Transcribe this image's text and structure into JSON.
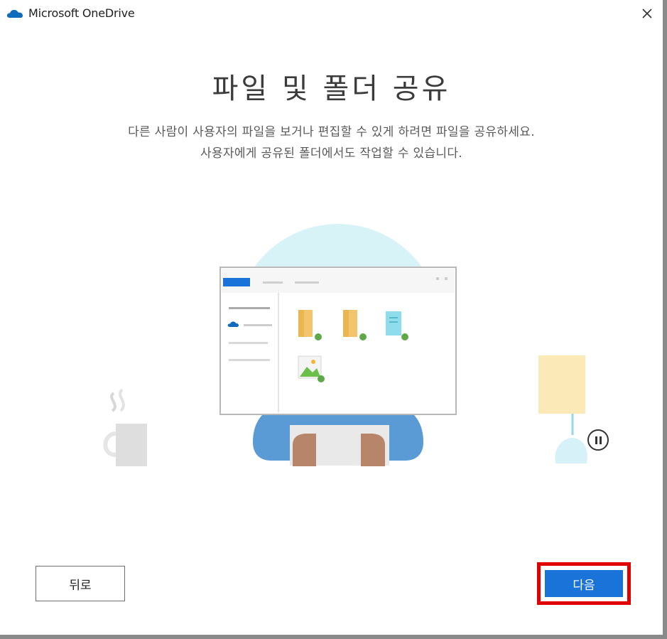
{
  "window": {
    "title": "Microsoft OneDrive",
    "close_label": "×"
  },
  "content": {
    "heading": "파일 및 폴더 공유",
    "description_line1": "다른 사람이 사용자의 파일을 보거나 편집할 수 있게 하려면 파일을 공유하세요.",
    "description_line2": "사용자에게 공유된 폴더에서도 작업할 수 있습니다."
  },
  "illustration": {
    "icons": [
      "mug-icon",
      "onedrive-cloud-icon",
      "folder-icon",
      "folder-icon",
      "document-icon",
      "image-icon",
      "lamp-icon"
    ],
    "pause_icon": "pause-icon"
  },
  "footer": {
    "back_label": "뒤로",
    "next_label": "다음"
  },
  "colors": {
    "accent": "#1a73d9",
    "highlight_border": "#e00000",
    "cloud": "#0f6cbd",
    "circle_bg": "#d8f3f8",
    "folder": "#f2c46b"
  }
}
